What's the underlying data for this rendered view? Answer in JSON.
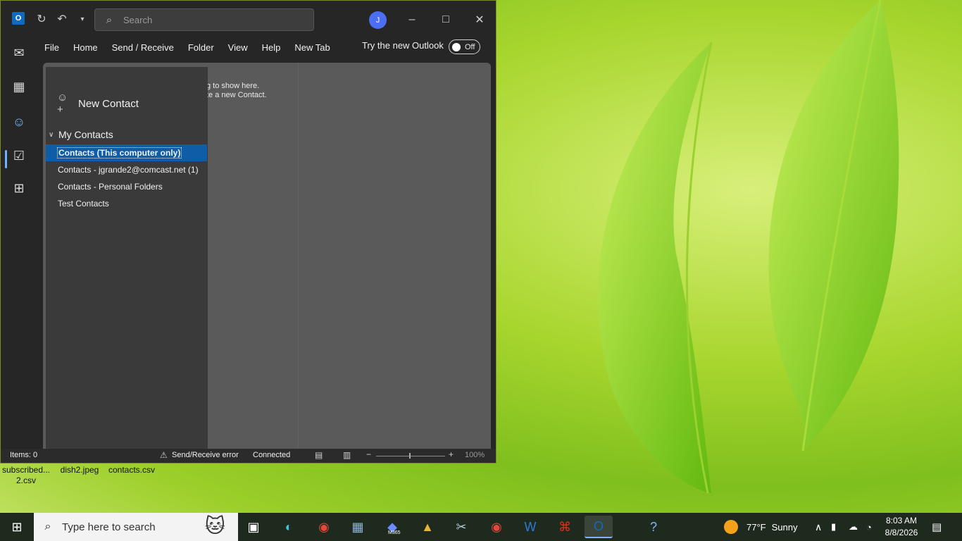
{
  "window": {
    "title_search_placeholder": "Search",
    "avatar_initial": "J",
    "menu": [
      "File",
      "Home",
      "Send / Receive",
      "Folder",
      "View",
      "Help",
      "New Tab"
    ],
    "try_new_outlook": "Try the new Outlook",
    "toggle_label": "Off"
  },
  "folder_pane": {
    "new_contact": "New Contact",
    "group_label": "My Contacts",
    "folders": [
      "Contacts (This computer only)",
      "Contacts - jgrande2@comcast.net (1)",
      "Contacts - Personal Folders",
      "Test Contacts"
    ]
  },
  "content": {
    "empty_line1": "g to show here.",
    "empty_line2": "te a new Contact."
  },
  "status": {
    "items": "Items: 0",
    "error": "Send/Receive error",
    "connected": "Connected",
    "zoom": "100%"
  },
  "desktop": {
    "icons": [
      {
        "line1": "subscribed...",
        "line2": "2.csv"
      },
      {
        "line1": "dish2.jpeg",
        "line2": ""
      },
      {
        "line1": "contacts.csv",
        "line2": ""
      }
    ]
  },
  "taskbar": {
    "search_placeholder": "Type here to search",
    "weather_temp": "77°F",
    "weather_text": "Sunny",
    "time": "8:03 AM",
    "date": "8/8/2026",
    "m365_label": "M365"
  },
  "colors": {
    "accent": "#0f5ca7",
    "window_bg": "#262626",
    "folder_pane_bg": "#3a3a3a"
  }
}
